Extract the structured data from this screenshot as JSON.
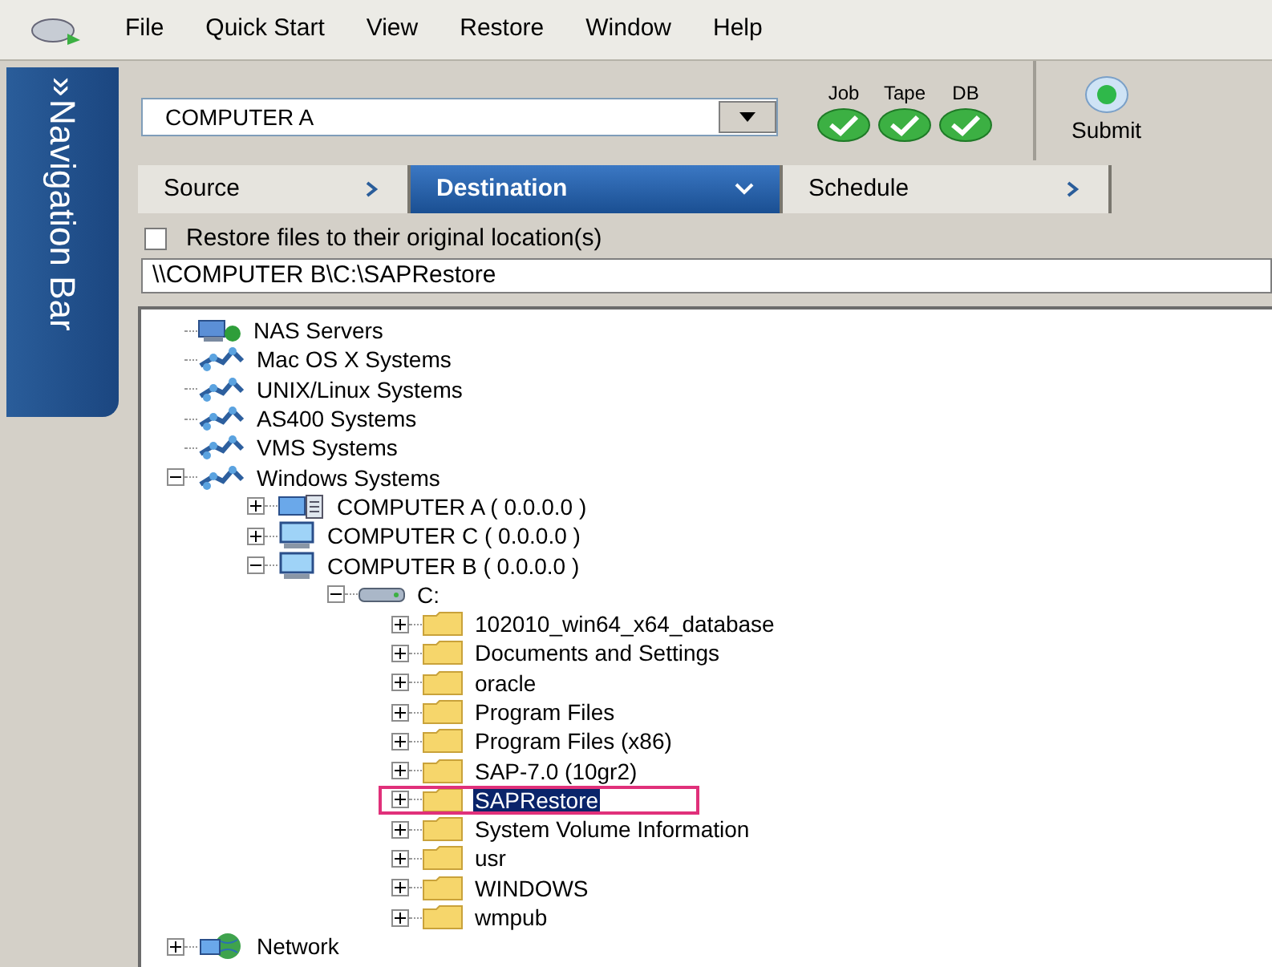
{
  "menu": [
    "File",
    "Quick Start",
    "View",
    "Restore",
    "Window",
    "Help"
  ],
  "navigation_bar": {
    "arrow": "»",
    "label": "Navigation Bar"
  },
  "server_combo": {
    "value": "COMPUTER A"
  },
  "status_lights": [
    {
      "label": "Job",
      "ok": true
    },
    {
      "label": "Tape",
      "ok": true
    },
    {
      "label": "DB",
      "ok": true
    }
  ],
  "submit_button": {
    "label": "Submit"
  },
  "tabs": [
    {
      "label": "Source",
      "selected": false
    },
    {
      "label": "Destination",
      "selected": true
    },
    {
      "label": "Schedule",
      "selected": false
    }
  ],
  "restore_original": {
    "label": "Restore files to their original location(s)",
    "checked": false
  },
  "destination_path": {
    "value": "\\\\COMPUTER B\\C:\\SAPRestore"
  },
  "tree": [
    {
      "label": "NAS Servers",
      "kind": "nas",
      "selected": false
    },
    {
      "label": "Mac OS X Systems",
      "kind": "group",
      "selected": false
    },
    {
      "label": "UNIX/Linux Systems",
      "kind": "group",
      "selected": false
    },
    {
      "label": "AS400 Systems",
      "kind": "group",
      "selected": false
    },
    {
      "label": "VMS Systems",
      "kind": "group",
      "selected": false
    },
    {
      "label": "Windows Systems",
      "kind": "group",
      "selected": false,
      "expanded": true,
      "children": [
        {
          "label": "COMPUTER A ( 0.0.0.0 )",
          "kind": "server",
          "selected": false,
          "expanded": false
        },
        {
          "label": "COMPUTER C ( 0.0.0.0 )",
          "kind": "computer",
          "selected": false,
          "expanded": false
        },
        {
          "label": "COMPUTER B ( 0.0.0.0 )",
          "kind": "computer",
          "selected": false,
          "expanded": true,
          "children": [
            {
              "label": "C:",
              "kind": "drive",
              "selected": false,
              "expanded": true,
              "children": [
                {
                  "label": "102010_win64_x64_database",
                  "kind": "folder",
                  "selected": false,
                  "expanded": false
                },
                {
                  "label": "Documents and Settings",
                  "kind": "folder",
                  "selected": false,
                  "expanded": false
                },
                {
                  "label": "oracle",
                  "kind": "folder",
                  "selected": false,
                  "expanded": false
                },
                {
                  "label": "Program Files",
                  "kind": "folder",
                  "selected": false,
                  "expanded": false
                },
                {
                  "label": "Program Files (x86)",
                  "kind": "folder",
                  "selected": false,
                  "expanded": false
                },
                {
                  "label": "SAP-7.0 (10gr2)",
                  "kind": "folder",
                  "selected": false,
                  "expanded": false
                },
                {
                  "label": "SAPRestore",
                  "kind": "folder",
                  "selected": true,
                  "expanded": false
                },
                {
                  "label": "System Volume Information",
                  "kind": "folder",
                  "selected": false,
                  "expanded": false
                },
                {
                  "label": "usr",
                  "kind": "folder",
                  "selected": false,
                  "expanded": false
                },
                {
                  "label": "WINDOWS",
                  "kind": "folder",
                  "selected": false,
                  "expanded": false
                },
                {
                  "label": "wmpub",
                  "kind": "folder",
                  "selected": false,
                  "expanded": false
                }
              ]
            }
          ]
        }
      ]
    },
    {
      "label": "Network",
      "kind": "network",
      "selected": false,
      "expanded": false
    }
  ]
}
